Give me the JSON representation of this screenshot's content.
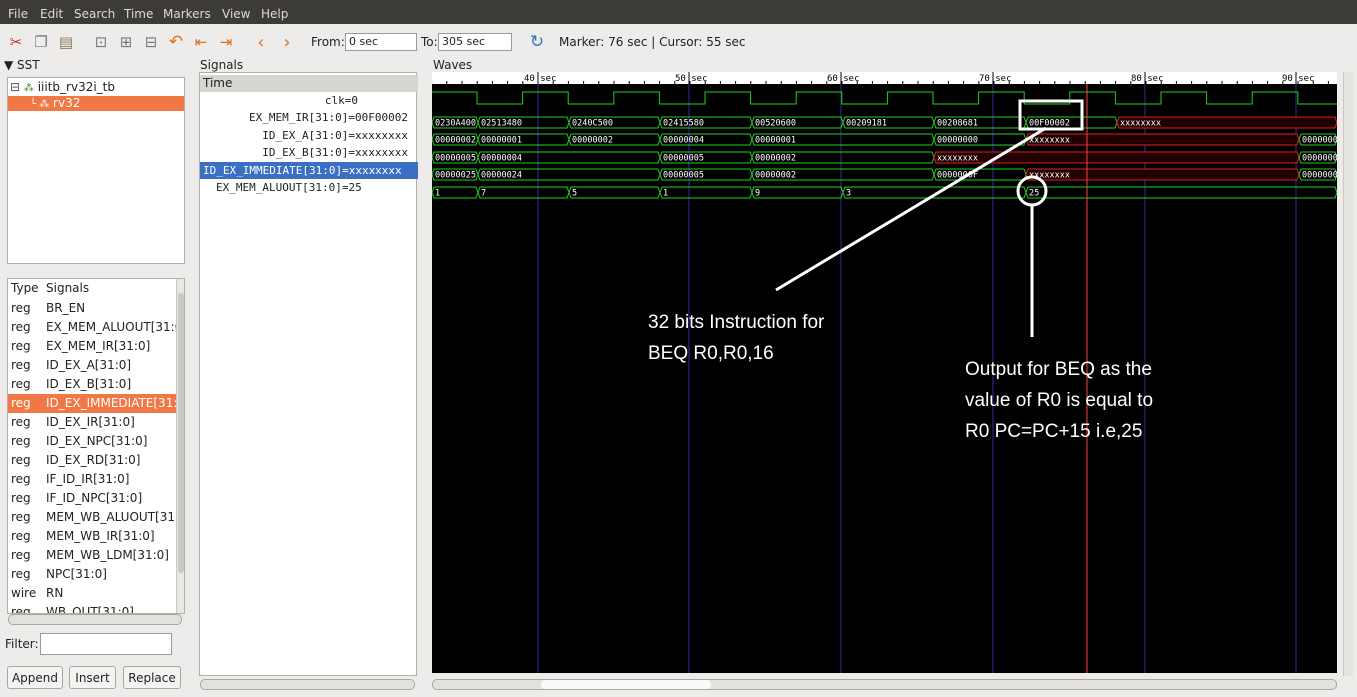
{
  "menu": [
    "File",
    "Edit",
    "Search",
    "Time",
    "Markers",
    "View",
    "Help"
  ],
  "toolbar": {
    "from_label": "From:",
    "from_value": "0 sec",
    "to_label": "To:",
    "to_value": "305 sec",
    "status": "Marker: 76 sec  |  Cursor: 55 sec"
  },
  "sst": {
    "title": "SST",
    "tree": [
      {
        "label": "iiitb_rv32i_tb"
      },
      {
        "label": "rv32"
      }
    ]
  },
  "signals_list": {
    "col_type": "Type",
    "col_signals": "Signals",
    "rows": [
      {
        "type": "reg",
        "name": "BR_EN"
      },
      {
        "type": "reg",
        "name": "EX_MEM_ALUOUT[31:0"
      },
      {
        "type": "reg",
        "name": "EX_MEM_IR[31:0]"
      },
      {
        "type": "reg",
        "name": "ID_EX_A[31:0]"
      },
      {
        "type": "reg",
        "name": "ID_EX_B[31:0]"
      },
      {
        "type": "reg",
        "name": "ID_EX_IMMEDIATE[31:0"
      },
      {
        "type": "reg",
        "name": "ID_EX_IR[31:0]"
      },
      {
        "type": "reg",
        "name": "ID_EX_NPC[31:0]"
      },
      {
        "type": "reg",
        "name": "ID_EX_RD[31:0]"
      },
      {
        "type": "reg",
        "name": "IF_ID_IR[31:0]"
      },
      {
        "type": "reg",
        "name": "IF_ID_NPC[31:0]"
      },
      {
        "type": "reg",
        "name": "MEM_WB_ALUOUT[31:"
      },
      {
        "type": "reg",
        "name": "MEM_WB_IR[31:0]"
      },
      {
        "type": "reg",
        "name": "MEM_WB_LDM[31:0]"
      },
      {
        "type": "reg",
        "name": "NPC[31:0]"
      },
      {
        "type": "wire",
        "name": "RN"
      },
      {
        "type": "reg",
        "name": "WB_OUT[31:0]"
      }
    ],
    "filter_label": "Filter:",
    "filter_value": "",
    "buttons": [
      "Append",
      "Insert",
      "Replace"
    ]
  },
  "signals_pane": {
    "title": "Signals",
    "time_label": "Time",
    "rows": [
      "clk=0",
      "EX_MEM_IR[31:0]=00F00002",
      "ID_EX_A[31:0]=xxxxxxxx",
      "ID_EX_B[31:0]=xxxxxxxx",
      "ID_EX_IMMEDIATE[31:0]=xxxxxxxx",
      "EX_MEM_ALUOUT[31:0]=25"
    ]
  },
  "waves": {
    "title": "Waves",
    "time_ticks": [
      "40 sec",
      "50 sec",
      "60 sec",
      "70 sec",
      "80 sec",
      "90 sec"
    ],
    "buses": [
      {
        "segments": [
          "0230A400",
          "02513480",
          "0240C500",
          "02415580",
          "00520600",
          "00209181",
          "00208681",
          "00F00002",
          "xxxxxxxx"
        ]
      },
      {
        "segments": [
          "00000002",
          "00000001",
          "00000002",
          "00000004",
          "00000001",
          "00000000",
          "xxxxxxxx",
          "0000000"
        ]
      },
      {
        "segments": [
          "00000005",
          "00000004",
          "00000005",
          "00000002",
          "xxxxxxxx",
          "0000000"
        ]
      },
      {
        "segments": [
          "00000025",
          "00000024",
          "00000005",
          "00000002",
          "0000000F",
          "xxxxxxxx",
          "0000000"
        ]
      },
      {
        "segments": [
          "1",
          "7",
          "5",
          "1",
          "9",
          "3",
          "25"
        ]
      }
    ],
    "colors": {
      "wave": "#20d020",
      "unknown": "#e02020",
      "marker": "#ff4040",
      "grid": "#3030a0",
      "background": "#000000"
    }
  },
  "annotations": {
    "instruction": [
      "32 bits Instruction for",
      "BEQ R0,R0,16"
    ],
    "output": [
      "Output for BEQ as the",
      "value of R0 is equal to",
      "R0 PC=PC+15 i.e,25"
    ]
  }
}
